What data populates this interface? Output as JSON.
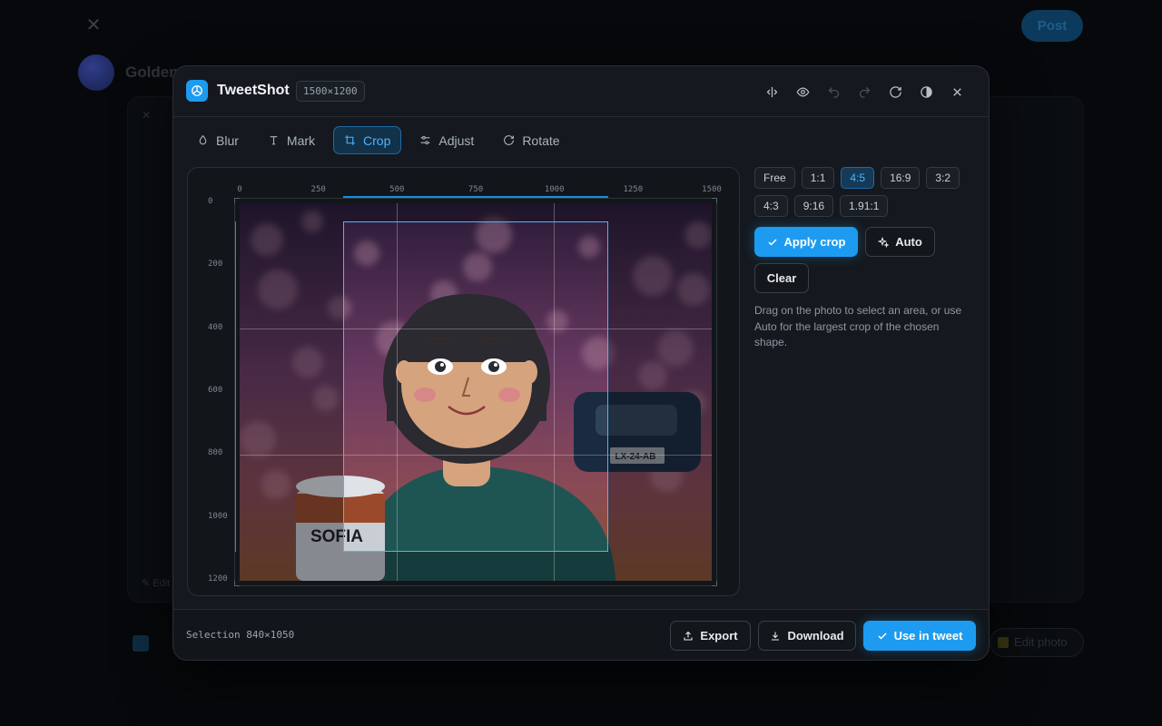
{
  "background": {
    "post_label": "Post",
    "name": "Golden",
    "edit_photo_label": "Edit photo",
    "card_edit_label": "✎ Edit"
  },
  "header": {
    "title": "TweetShot",
    "dimensions": "1500×1200"
  },
  "tabs": [
    {
      "label": "Blur",
      "icon": "droplet-icon"
    },
    {
      "label": "Mark",
      "icon": "text-icon"
    },
    {
      "label": "Crop",
      "icon": "crop-icon",
      "active": true
    },
    {
      "label": "Adjust",
      "icon": "sliders-icon"
    },
    {
      "label": "Rotate",
      "icon": "rotate-icon"
    }
  ],
  "ruler": {
    "x_ticks": [
      "0",
      "250",
      "500",
      "750",
      "1000",
      "1250",
      "1500"
    ],
    "y_ticks": [
      "0",
      "200",
      "400",
      "600",
      "800",
      "1000",
      "1200"
    ]
  },
  "image": {
    "jar_label": "SOFIA",
    "plate_text": "LX-24-AB"
  },
  "crop": {
    "ratios": [
      "Free",
      "1:1",
      "4:5",
      "16:9",
      "3:2",
      "4:3",
      "9:16",
      "1.91:1"
    ],
    "active_ratio": "4:5",
    "apply_label": "Apply crop",
    "auto_label": "Auto",
    "clear_label": "Clear",
    "help_text": "Drag on the photo to select an area, or use Auto for the largest crop of the chosen shape."
  },
  "footer": {
    "selection": "Selection 840×1050",
    "export_label": "Export",
    "download_label": "Download",
    "use_label": "Use in tweet"
  },
  "colors": {
    "accent": "#1d9bf0",
    "panel": "#15191f"
  }
}
